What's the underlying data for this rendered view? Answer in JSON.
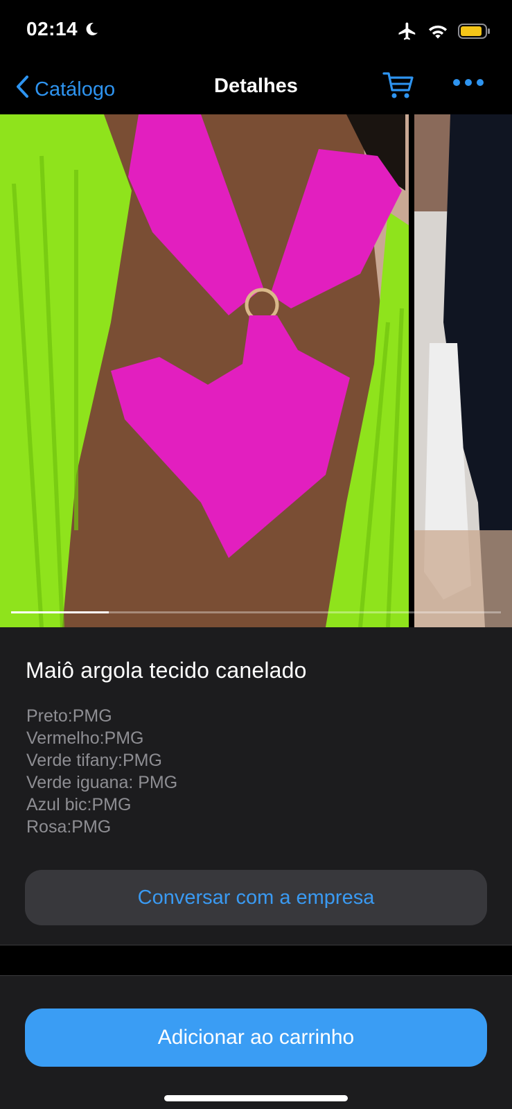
{
  "status_bar": {
    "time": "02:14",
    "icons": [
      "moon-icon",
      "airplane-icon",
      "wifi-icon",
      "battery-icon"
    ],
    "battery_color": "#f5c518"
  },
  "nav": {
    "back_label": "Catálogo",
    "title": "Detalhes",
    "accent_color": "#2e94f0"
  },
  "carousel": {
    "page_count": 5,
    "current_page": 1
  },
  "product": {
    "title": "Maiô argola tecido canelado",
    "description_lines": [
      "Preto:PMG",
      "Vermelho:PMG",
      "Verde tifany:PMG",
      "Verde iguana: PMG",
      "Azul bic:PMG",
      "Rosa:PMG"
    ]
  },
  "actions": {
    "chat_label": "Conversar com a empresa",
    "add_to_cart_label": "Adicionar ao carrinho"
  }
}
